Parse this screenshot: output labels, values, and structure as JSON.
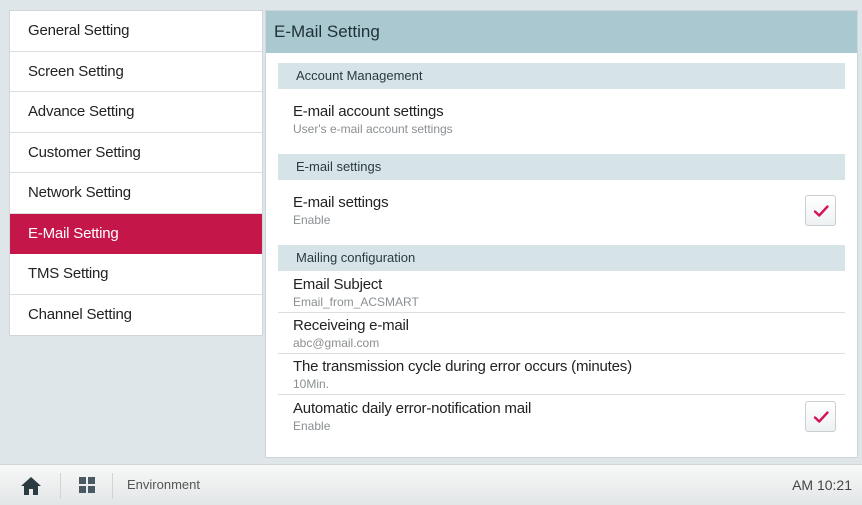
{
  "sidebar": {
    "items": [
      {
        "label": "General Setting"
      },
      {
        "label": "Screen Setting"
      },
      {
        "label": "Advance Setting"
      },
      {
        "label": "Customer Setting"
      },
      {
        "label": "Network Setting"
      },
      {
        "label": "E-Mail Setting",
        "active": true
      },
      {
        "label": "TMS Setting"
      },
      {
        "label": "Channel Setting"
      }
    ]
  },
  "main": {
    "title": "E-Mail Setting",
    "sections": {
      "account": {
        "header": "Account Management",
        "account_settings": {
          "title": "E-mail account settings",
          "subtitle": "User's e-mail account settings"
        }
      },
      "email": {
        "header": "E-mail settings",
        "email_settings": {
          "title": "E-mail settings",
          "subtitle": "Enable",
          "checked": true
        }
      },
      "mailing": {
        "header": "Mailing configuration",
        "subject": {
          "title": "Email Subject",
          "value": "Email_from_ACSMART"
        },
        "receiving": {
          "title": "Receiveing e-mail",
          "value": "abc@gmail.com"
        },
        "cycle": {
          "title": "The transmission cycle during error occurs (minutes)",
          "value": "10Min."
        },
        "daily": {
          "title": "Automatic daily error-notification mail",
          "value": "Enable",
          "checked": true
        }
      }
    }
  },
  "bottombar": {
    "home_icon": "home-icon",
    "grid_icon": "grid-menu-icon",
    "label": "Environment",
    "clock": "AM 10:21"
  },
  "colors": {
    "accent": "#c5164a",
    "header_bg": "#a9c8d0",
    "section_bg": "#d6e4e8",
    "page_bg": "#dfe6e9"
  }
}
